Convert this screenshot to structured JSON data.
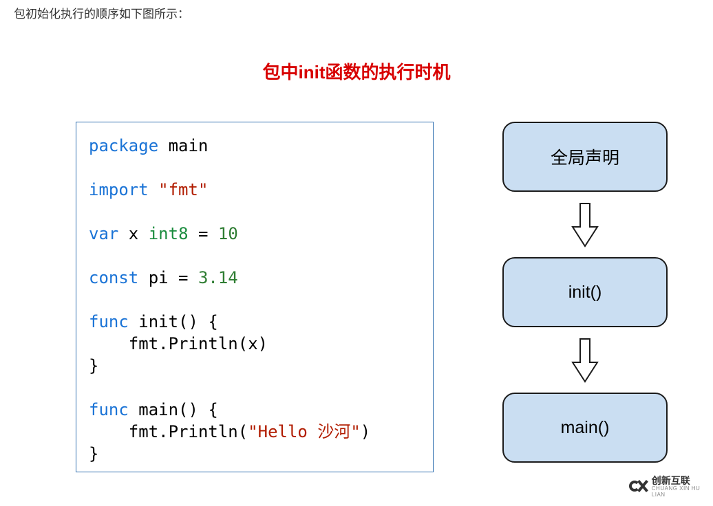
{
  "intro": "包初始化执行的顺序如下图所示：",
  "title": "包中init函数的执行时机",
  "code": {
    "l1a": "package",
    "l1b": " main",
    "l2a": "import",
    "l2b": " ",
    "l2c": "\"fmt\"",
    "l3a": "var",
    "l3b": " x ",
    "l3c": "int8",
    "l3d": " = ",
    "l3e": "10",
    "l4a": "const",
    "l4b": " pi = ",
    "l4c": "3.14",
    "l5a": "func",
    "l5b": " init() {",
    "l6": "    fmt.Println(x)",
    "l7": "}",
    "l8a": "func",
    "l8b": " main() {",
    "l9a": "    fmt.Println(",
    "l9b": "\"Hello 沙河\"",
    "l9c": ")",
    "l10": "}"
  },
  "flow": {
    "box1": "全局声明",
    "box2": "init()",
    "box3": "main()"
  },
  "watermark": {
    "cn": "创新互联",
    "en": "CHUANG XIN HU LIAN"
  }
}
